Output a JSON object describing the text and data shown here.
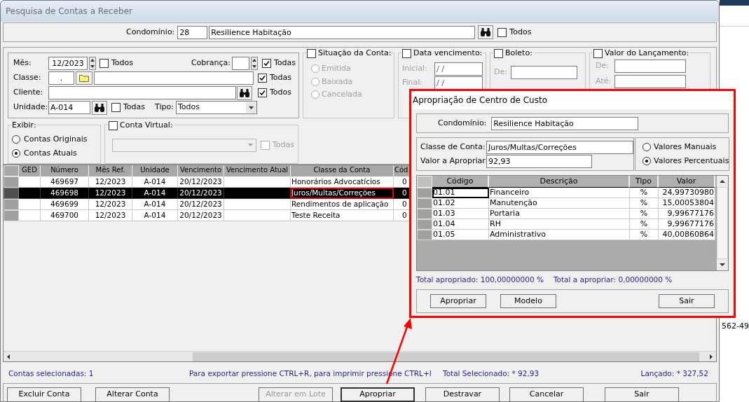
{
  "window": {
    "title": "Pesquisa de Contas a Receber"
  },
  "condominio": {
    "label": "Condomínio:",
    "code": "28",
    "name": "Resilience Habitação",
    "todos": {
      "label": "Todos",
      "checked": false
    }
  },
  "filters": {
    "mes": {
      "label": "Mês:",
      "value": "12/2023",
      "todos": {
        "label": "Todos",
        "checked": false
      }
    },
    "cobranca": {
      "label": "Cobrança:",
      "todas": {
        "label": "Todas",
        "checked": true
      }
    },
    "classe": {
      "label": "Classe:",
      "code": ".",
      "todas": {
        "label": "Todas",
        "checked": true
      }
    },
    "cliente": {
      "label": "Cliente:",
      "todos": {
        "label": "Todos",
        "checked": true
      }
    },
    "unidade": {
      "label": "Unidade:",
      "value": "A-014",
      "todas": {
        "label": "Todas",
        "checked": false
      }
    },
    "tipo": {
      "label": "Tipo:",
      "value": "Todos"
    }
  },
  "situacao": {
    "label": "Situação da Conta:",
    "checked": false,
    "options": [
      {
        "label": "Emitida",
        "selected": false
      },
      {
        "label": "Baixada",
        "selected": false
      },
      {
        "label": "Cancelada",
        "selected": false
      }
    ]
  },
  "data_vencimento": {
    "label": "Data vencimento:",
    "checked": false,
    "inicial": {
      "label": "Inicial:",
      "value": " / /"
    },
    "final": {
      "label": "Final:",
      "value": " / /"
    }
  },
  "boleto": {
    "label": "Boleto:",
    "checked": false,
    "de": {
      "label": "De:"
    }
  },
  "valor_lancamento": {
    "label": "Valor do Lançamento:",
    "checked": false,
    "de": {
      "label": "De:"
    },
    "ate": {
      "label": "Até:"
    }
  },
  "exibir": {
    "label": "Exibir:",
    "options": [
      {
        "label": "Contas Originais",
        "selected": false
      },
      {
        "label": "Contas Atuais",
        "selected": true
      }
    ]
  },
  "conta_virtual": {
    "label": "Conta Virtual:",
    "checked": false,
    "todas": {
      "label": "Todas",
      "checked": false
    }
  },
  "table": {
    "columns": [
      "GED",
      "Número",
      "Mês Ref.",
      "Unidade",
      "Vencimento",
      "Vencimento Atual",
      "Classe da Conta",
      "Cód"
    ],
    "rows": [
      {
        "selected": false,
        "highlighted": false,
        "cells": [
          "",
          "469697",
          "12/2023",
          "A-014",
          "20/12/2023",
          "",
          "Honorários Advocatícios",
          "0"
        ]
      },
      {
        "selected": true,
        "highlighted": true,
        "cells": [
          "",
          "469698",
          "12/2023",
          "A-014",
          "20/12/2023",
          "",
          "Juros/Multas/Correções",
          "0"
        ]
      },
      {
        "selected": false,
        "highlighted": false,
        "cells": [
          "",
          "469699",
          "12/2023",
          "A-014",
          "20/12/2023",
          "",
          "Rendimentos de aplicação",
          "0"
        ]
      },
      {
        "selected": false,
        "highlighted": false,
        "cells": [
          "",
          "469700",
          "12/2023",
          "A-014",
          "20/12/2023",
          "",
          "Teste Receita",
          "0"
        ]
      }
    ]
  },
  "status_bar": {
    "selecionadas": "Contas selecionadas: 1",
    "hint": "Para exportar pressione CTRL+R,  para imprimir pressione CTRL+I",
    "total": "Total Selecionado: * 92,93",
    "lancado": "Lançado: * 327,52"
  },
  "buttons": [
    {
      "label": "Excluir Conta",
      "disabled": false,
      "focused": false
    },
    {
      "label": "Alterar Conta",
      "disabled": false,
      "focused": false
    },
    {
      "label": "Alterar em Lote",
      "disabled": true,
      "focused": false
    },
    {
      "label": "Apropriar",
      "disabled": false,
      "focused": true
    },
    {
      "label": "Destravar",
      "disabled": false,
      "focused": false
    },
    {
      "label": "Cancelar",
      "disabled": false,
      "focused": false
    },
    {
      "label": "Sair",
      "disabled": false,
      "focused": false
    }
  ],
  "dialog": {
    "title": "Apropriação de Centro de Custo",
    "condominio": {
      "label": "Condomínio:",
      "value": "Resilience Habitação"
    },
    "classe": {
      "label": "Classe de Conta:",
      "value": "Juros/Multas/Correções"
    },
    "valor": {
      "label": "Valor a Apropriar:",
      "value": "92,93"
    },
    "modes": [
      {
        "label": "Valores Manuais",
        "selected": false
      },
      {
        "label": "Valores Percentuais",
        "selected": true
      }
    ],
    "table": {
      "columns": [
        "Código",
        "Descrição",
        "Tipo",
        "Valor"
      ],
      "rows": [
        {
          "focused": true,
          "cells": [
            "01.01",
            "Financeiro",
            "%",
            "24,99730980"
          ]
        },
        {
          "focused": false,
          "cells": [
            "01.02",
            "Manutenção",
            "%",
            "15,00053804"
          ]
        },
        {
          "focused": false,
          "cells": [
            "01.03",
            "Portaria",
            "%",
            "9,99677176"
          ]
        },
        {
          "focused": false,
          "cells": [
            "01.04",
            "RH",
            "%",
            "9,99677176"
          ]
        },
        {
          "focused": false,
          "cells": [
            "01.05",
            "Administrativo",
            "%",
            "40,00860864"
          ]
        }
      ]
    },
    "total_apropriado": "Total apropriado: 100,00000000 %",
    "total_a_apropriar": "Total a apropriar: 0,00000000 %",
    "buttons": [
      "Apropriar",
      "Modelo",
      "Sair"
    ]
  },
  "background_app": {
    "text": "562-49"
  }
}
